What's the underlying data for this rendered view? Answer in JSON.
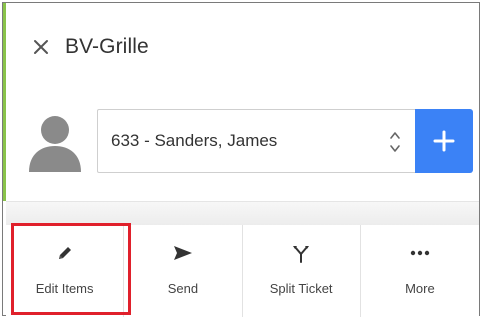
{
  "header": {
    "title": "BV-Grille",
    "close_icon": "close-icon"
  },
  "customer": {
    "selected": "633 - Sanders, James",
    "add_icon": "plus-icon"
  },
  "toolbar": {
    "items": [
      {
        "label": "Edit Items",
        "icon": "pencil-icon"
      },
      {
        "label": "Send",
        "icon": "send-icon"
      },
      {
        "label": "Split Ticket",
        "icon": "split-icon"
      },
      {
        "label": "More",
        "icon": "more-icon"
      }
    ]
  },
  "colors": {
    "accent": "#3b82f6",
    "highlight": "#e0202b",
    "green_bar": "#8ac34a"
  }
}
